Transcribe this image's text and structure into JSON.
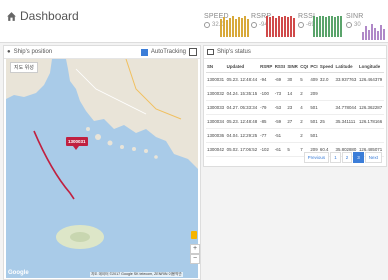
{
  "header": {
    "title": "Dashboard",
    "metrics": [
      {
        "label": "SPEED",
        "value": "32.0"
      },
      {
        "label": "RSRP",
        "value": "-94"
      },
      {
        "label": "RSSI",
        "value": "-69"
      },
      {
        "label": "SINR",
        "value": "30"
      }
    ],
    "colors": {
      "speed": "#d8a93a",
      "rsrp": "#d04a4a",
      "rssi": "#5aa46b",
      "sinr": "#b088c8"
    }
  },
  "left_panel": {
    "title": "Ship's position",
    "auto_tracking_label": "AutoTracking",
    "map_type_toggle": "지도 위성",
    "marker_label": "1300031",
    "footer": "지도 데이터 ©2017 Google SK telecom, ZENRIN 이용약관",
    "google_logo": "Google"
  },
  "right_panel": {
    "title": "Ship's status",
    "columns": [
      "SN",
      "Updated",
      "RSRP",
      "RSSI",
      "SINR",
      "CQI",
      "PCI",
      "Speed",
      "Latitude",
      "Longitude"
    ],
    "rows": [
      [
        "1300031",
        "05.23. 12:48:44",
        "-94",
        "-69",
        "30",
        "5",
        "409",
        "32.0",
        "33.937763",
        "126.464379"
      ],
      [
        "1300032",
        "04.24. 15:35:15",
        "-100",
        "-73",
        "14",
        "2",
        "209",
        "",
        "",
        ""
      ],
      [
        "1300033",
        "04.27. 05:33:34",
        "-79",
        "-53",
        "23",
        "4",
        "501",
        "",
        "34.778044",
        "126.362287"
      ],
      [
        "1300034",
        "05.23. 12:48:48",
        "-85",
        "-59",
        "27",
        "2",
        "501",
        "25",
        "35.341111",
        "126.178166"
      ],
      [
        "1300036",
        "04.04. 12:29:25",
        "-77",
        "-51",
        "",
        "2",
        "501",
        "",
        "",
        ""
      ],
      [
        "1300042",
        "05.02. 17:06:52",
        "-102",
        "-61",
        "5",
        "7",
        "209",
        "60.4",
        "35.802880",
        "126.485071"
      ]
    ],
    "pagination": [
      "Previous",
      "1",
      "2",
      "3",
      "Next"
    ],
    "active_page": "3"
  }
}
